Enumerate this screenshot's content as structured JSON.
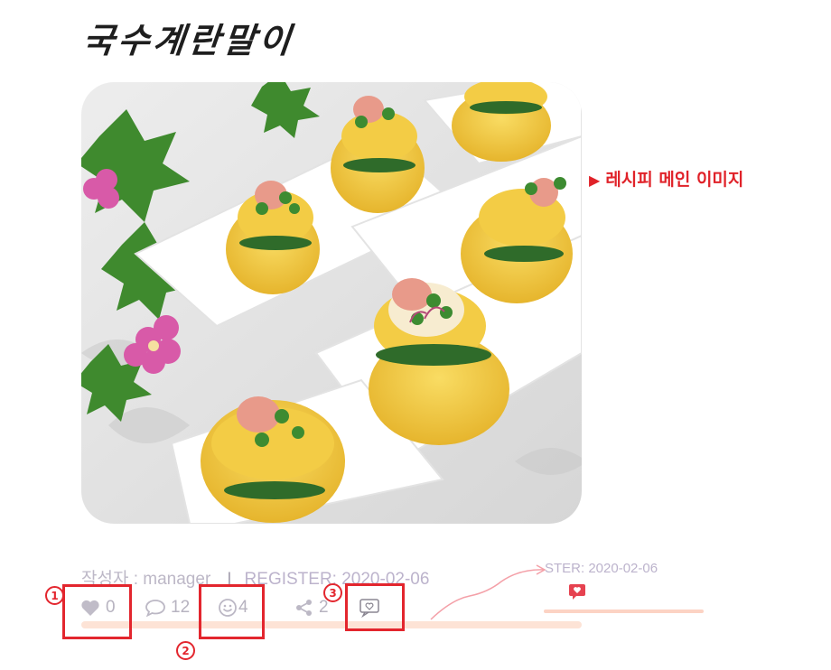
{
  "recipe": {
    "title": "국수계란말이",
    "main_image_label": "레시피 메인 이미지",
    "main_image_label_arrow": "▶"
  },
  "meta": {
    "author": "작성자 : manager",
    "separator": "I",
    "register": "REGISTER: 2020-02-06",
    "register_zoomed": "STER: 2020-02-06"
  },
  "stats": {
    "likes": "0",
    "comments": "12",
    "emoji": "4",
    "shares": "2"
  },
  "annotations": {
    "marker_1": "①",
    "marker_2": "②",
    "marker_3": "③"
  },
  "colors": {
    "annotation_red": "#e3262e",
    "meta_gray": "#bdb8c7",
    "track_peach": "#fde3d6",
    "comment_icon_red": "#e64250"
  }
}
